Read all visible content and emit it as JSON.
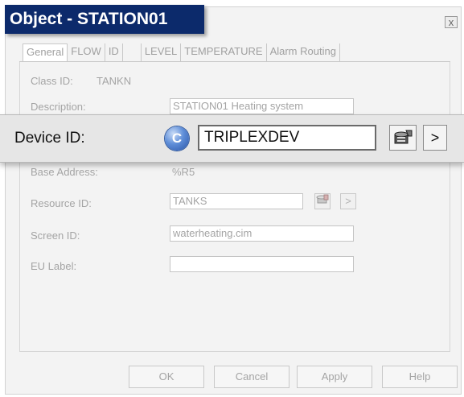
{
  "window": {
    "title": "Object - STATION01",
    "close_glyph": "x"
  },
  "tabs": [
    {
      "label": "General"
    },
    {
      "label": "FLOW"
    },
    {
      "label": "ID"
    },
    {
      "label": "LEVEL"
    },
    {
      "label": "TEMPERATURE"
    },
    {
      "label": "Alarm Routing"
    }
  ],
  "fields": {
    "class_id": {
      "label": "Class ID:",
      "value": "TANKN"
    },
    "description": {
      "label": "Description:",
      "value": "STATION01 Heating system"
    },
    "base_address": {
      "label": "Base Address:",
      "value": "%R5"
    },
    "resource_id": {
      "label": "Resource ID:",
      "value": "TANKS"
    },
    "screen_id": {
      "label": "Screen ID:",
      "value": "waterheating.cim"
    },
    "eu_label": {
      "label": "EU Label:",
      "value": ""
    }
  },
  "device_id": {
    "label": "Device ID:",
    "badge": "C",
    "value": "TRIPLEXDEV",
    "arrow": ">"
  },
  "resource_arrow": ">",
  "buttons": {
    "ok": "OK",
    "cancel": "Cancel",
    "apply": "Apply",
    "help": "Help"
  },
  "icons": [
    "close-icon",
    "c-badge-icon",
    "device-browse-icon",
    "resource-browse-icon",
    "arrow-right-icon"
  ]
}
